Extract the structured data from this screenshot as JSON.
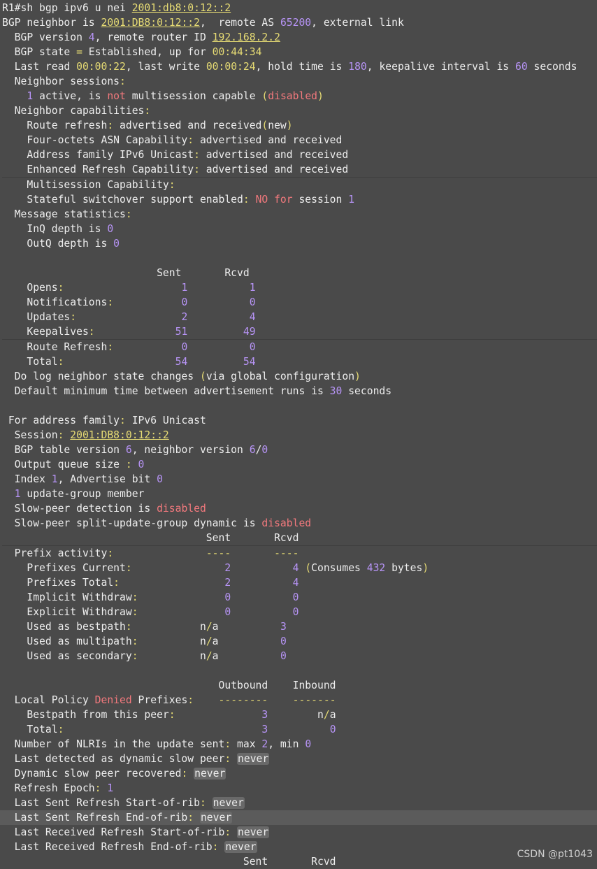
{
  "terminal": {
    "lines": [
      {
        "segs": [
          {
            "t": "R1#sh bgp ipv6 u nei "
          },
          {
            "t": "2001:db8:0:12::2",
            "c": "lnk"
          }
        ]
      },
      {
        "segs": [
          {
            "t": "BGP neighbor is "
          },
          {
            "t": "2001:DB8:0:12::2",
            "c": "lnk"
          },
          {
            "t": ",  remote AS "
          },
          {
            "t": "65200",
            "c": "num"
          },
          {
            "t": ", external link"
          }
        ]
      },
      {
        "segs": [
          {
            "t": "  BGP version "
          },
          {
            "t": "4",
            "c": "num"
          },
          {
            "t": ", remote router ID "
          },
          {
            "t": "192.168.2.2",
            "c": "lnk"
          }
        ]
      },
      {
        "segs": [
          {
            "t": "  BGP state "
          },
          {
            "t": "=",
            "c": "yel"
          },
          {
            "t": " Established, up for "
          },
          {
            "t": "00:44:34",
            "c": "yel"
          }
        ]
      },
      {
        "segs": [
          {
            "t": "  Last read "
          },
          {
            "t": "00:00:22",
            "c": "yel"
          },
          {
            "t": ", last write "
          },
          {
            "t": "00:00:24",
            "c": "yel"
          },
          {
            "t": ", hold time is "
          },
          {
            "t": "180",
            "c": "num"
          },
          {
            "t": ", keepalive interval is "
          },
          {
            "t": "60",
            "c": "num"
          },
          {
            "t": " seconds"
          }
        ]
      },
      {
        "segs": [
          {
            "t": "  Neighbor sessions"
          },
          {
            "t": ":",
            "c": "yel"
          }
        ]
      },
      {
        "segs": [
          {
            "t": "    "
          },
          {
            "t": "1",
            "c": "num"
          },
          {
            "t": " active, is "
          },
          {
            "t": "not",
            "c": "red"
          },
          {
            "t": " multisession capable "
          },
          {
            "t": "(",
            "c": "yel"
          },
          {
            "t": "disabled",
            "c": "red"
          },
          {
            "t": ")",
            "c": "yel"
          }
        ]
      },
      {
        "segs": [
          {
            "t": "  Neighbor capabilities"
          },
          {
            "t": ":",
            "c": "yel"
          }
        ]
      },
      {
        "segs": [
          {
            "t": "    Route refresh"
          },
          {
            "t": ":",
            "c": "yel"
          },
          {
            "t": " advertised and received"
          },
          {
            "t": "(",
            "c": "yel"
          },
          {
            "t": "new"
          },
          {
            "t": ")",
            "c": "yel"
          }
        ]
      },
      {
        "segs": [
          {
            "t": "    Four-octets ASN Capability"
          },
          {
            "t": ":",
            "c": "yel"
          },
          {
            "t": " advertised and received"
          }
        ]
      },
      {
        "segs": [
          {
            "t": "    Address family IPv6 Unicast"
          },
          {
            "t": ":",
            "c": "yel"
          },
          {
            "t": " advertised and received"
          }
        ]
      },
      {
        "segs": [
          {
            "t": "    Enhanced Refresh Capability"
          },
          {
            "t": ":",
            "c": "yel"
          },
          {
            "t": " advertised and received"
          }
        ]
      },
      {
        "sep": true,
        "segs": [
          {
            "t": "    Multisession Capability"
          },
          {
            "t": ":",
            "c": "yel"
          }
        ]
      },
      {
        "segs": [
          {
            "t": "    Stateful switchover support enabled"
          },
          {
            "t": ":",
            "c": "yel"
          },
          {
            "t": " "
          },
          {
            "t": "NO",
            "c": "red"
          },
          {
            "t": " "
          },
          {
            "t": "for",
            "c": "red"
          },
          {
            "t": " session "
          },
          {
            "t": "1",
            "c": "num"
          }
        ]
      },
      {
        "segs": [
          {
            "t": "  Message statistics"
          },
          {
            "t": ":",
            "c": "yel"
          }
        ]
      },
      {
        "segs": [
          {
            "t": "    InQ depth is "
          },
          {
            "t": "0",
            "c": "num"
          }
        ]
      },
      {
        "segs": [
          {
            "t": "    OutQ depth is "
          },
          {
            "t": "0",
            "c": "num"
          }
        ]
      },
      {
        "segs": []
      },
      {
        "segs": [
          {
            "t": "                         Sent       Rcvd"
          }
        ]
      },
      {
        "segs": [
          {
            "t": "    Opens"
          },
          {
            "t": ":",
            "c": "yel"
          },
          {
            "t": "                   "
          },
          {
            "t": "1",
            "c": "num"
          },
          {
            "t": "          "
          },
          {
            "t": "1",
            "c": "num"
          }
        ]
      },
      {
        "segs": [
          {
            "t": "    Notifications"
          },
          {
            "t": ":",
            "c": "yel"
          },
          {
            "t": "           "
          },
          {
            "t": "0",
            "c": "num"
          },
          {
            "t": "          "
          },
          {
            "t": "0",
            "c": "num"
          }
        ]
      },
      {
        "segs": [
          {
            "t": "    Updates"
          },
          {
            "t": ":",
            "c": "yel"
          },
          {
            "t": "                 "
          },
          {
            "t": "2",
            "c": "num"
          },
          {
            "t": "          "
          },
          {
            "t": "4",
            "c": "num"
          }
        ]
      },
      {
        "segs": [
          {
            "t": "    Keepalives"
          },
          {
            "t": ":",
            "c": "yel"
          },
          {
            "t": "             "
          },
          {
            "t": "51",
            "c": "num"
          },
          {
            "t": "         "
          },
          {
            "t": "49",
            "c": "num"
          }
        ]
      },
      {
        "sep": true,
        "segs": [
          {
            "t": "    Route Refresh"
          },
          {
            "t": ":",
            "c": "yel"
          },
          {
            "t": "           "
          },
          {
            "t": "0",
            "c": "num"
          },
          {
            "t": "          "
          },
          {
            "t": "0",
            "c": "num"
          }
        ]
      },
      {
        "segs": [
          {
            "t": "    Total"
          },
          {
            "t": ":",
            "c": "yel"
          },
          {
            "t": "                  "
          },
          {
            "t": "54",
            "c": "num"
          },
          {
            "t": "         "
          },
          {
            "t": "54",
            "c": "num"
          }
        ]
      },
      {
        "segs": [
          {
            "t": "  Do log neighbor state changes "
          },
          {
            "t": "(",
            "c": "yel"
          },
          {
            "t": "via global configuration"
          },
          {
            "t": ")",
            "c": "yel"
          }
        ]
      },
      {
        "segs": [
          {
            "t": "  Default minimum time between advertisement runs is "
          },
          {
            "t": "30",
            "c": "num"
          },
          {
            "t": " seconds"
          }
        ]
      },
      {
        "segs": []
      },
      {
        "segs": [
          {
            "t": " For address family"
          },
          {
            "t": ":",
            "c": "yel"
          },
          {
            "t": " IPv6 Unicast"
          }
        ]
      },
      {
        "segs": [
          {
            "t": "  Session"
          },
          {
            "t": ":",
            "c": "yel"
          },
          {
            "t": " "
          },
          {
            "t": "2001:DB8:0:12::2",
            "c": "lnk"
          }
        ]
      },
      {
        "segs": [
          {
            "t": "  BGP table version "
          },
          {
            "t": "6",
            "c": "num"
          },
          {
            "t": ", neighbor version "
          },
          {
            "t": "6",
            "c": "num"
          },
          {
            "t": "/"
          },
          {
            "t": "0",
            "c": "num"
          }
        ]
      },
      {
        "segs": [
          {
            "t": "  Output queue size "
          },
          {
            "t": ":",
            "c": "yel"
          },
          {
            "t": " "
          },
          {
            "t": "0",
            "c": "num"
          }
        ]
      },
      {
        "segs": [
          {
            "t": "  Index "
          },
          {
            "t": "1",
            "c": "num"
          },
          {
            "t": ", Advertise bit "
          },
          {
            "t": "0",
            "c": "num"
          }
        ]
      },
      {
        "segs": [
          {
            "t": "  "
          },
          {
            "t": "1",
            "c": "num"
          },
          {
            "t": " update-group member"
          }
        ]
      },
      {
        "segs": [
          {
            "t": "  Slow-peer detection is "
          },
          {
            "t": "disabled",
            "c": "red"
          }
        ]
      },
      {
        "segs": [
          {
            "t": "  Slow-peer split-update-group dynamic is "
          },
          {
            "t": "disabled",
            "c": "red"
          }
        ]
      },
      {
        "segs": [
          {
            "t": "                                 Sent       Rcvd"
          }
        ]
      },
      {
        "sep": true,
        "segs": [
          {
            "t": "  Prefix activity"
          },
          {
            "t": ":",
            "c": "yel"
          },
          {
            "t": "               "
          },
          {
            "t": "----",
            "c": "yel"
          },
          {
            "t": "       "
          },
          {
            "t": "----",
            "c": "yel"
          }
        ]
      },
      {
        "segs": [
          {
            "t": "    Prefixes Current"
          },
          {
            "t": ":",
            "c": "yel"
          },
          {
            "t": "               "
          },
          {
            "t": "2",
            "c": "num"
          },
          {
            "t": "          "
          },
          {
            "t": "4",
            "c": "num"
          },
          {
            "t": " "
          },
          {
            "t": "(",
            "c": "yel"
          },
          {
            "t": "Consumes "
          },
          {
            "t": "432",
            "c": "num"
          },
          {
            "t": " bytes"
          },
          {
            "t": ")",
            "c": "yel"
          }
        ]
      },
      {
        "segs": [
          {
            "t": "    Prefixes Total"
          },
          {
            "t": ":",
            "c": "yel"
          },
          {
            "t": "                 "
          },
          {
            "t": "2",
            "c": "num"
          },
          {
            "t": "          "
          },
          {
            "t": "4",
            "c": "num"
          }
        ]
      },
      {
        "segs": [
          {
            "t": "    Implicit Withdraw"
          },
          {
            "t": ":",
            "c": "yel"
          },
          {
            "t": "              "
          },
          {
            "t": "0",
            "c": "num"
          },
          {
            "t": "          "
          },
          {
            "t": "0",
            "c": "num"
          }
        ]
      },
      {
        "segs": [
          {
            "t": "    Explicit Withdraw"
          },
          {
            "t": ":",
            "c": "yel"
          },
          {
            "t": "              "
          },
          {
            "t": "0",
            "c": "num"
          },
          {
            "t": "          "
          },
          {
            "t": "0",
            "c": "num"
          }
        ]
      },
      {
        "segs": [
          {
            "t": "    Used as bestpath"
          },
          {
            "t": ":",
            "c": "yel"
          },
          {
            "t": "           n"
          },
          {
            "t": "/",
            "c": "yel"
          },
          {
            "t": "a          "
          },
          {
            "t": "3",
            "c": "num"
          }
        ]
      },
      {
        "segs": [
          {
            "t": "    Used as multipath"
          },
          {
            "t": ":",
            "c": "yel"
          },
          {
            "t": "          n"
          },
          {
            "t": "/",
            "c": "yel"
          },
          {
            "t": "a          "
          },
          {
            "t": "0",
            "c": "num"
          }
        ]
      },
      {
        "segs": [
          {
            "t": "    Used as secondary"
          },
          {
            "t": ":",
            "c": "yel"
          },
          {
            "t": "          n"
          },
          {
            "t": "/",
            "c": "yel"
          },
          {
            "t": "a          "
          },
          {
            "t": "0",
            "c": "num"
          }
        ]
      },
      {
        "segs": []
      },
      {
        "segs": [
          {
            "t": "                                   Outbound    Inbound"
          }
        ]
      },
      {
        "segs": [
          {
            "t": "  Local Policy "
          },
          {
            "t": "Denied",
            "c": "red"
          },
          {
            "t": " Prefixes"
          },
          {
            "t": ":",
            "c": "yel"
          },
          {
            "t": "    "
          },
          {
            "t": "--------",
            "c": "yel"
          },
          {
            "t": "    "
          },
          {
            "t": "-------",
            "c": "yel"
          }
        ]
      },
      {
        "segs": [
          {
            "t": "    Bestpath from this peer"
          },
          {
            "t": ":",
            "c": "yel"
          },
          {
            "t": "              "
          },
          {
            "t": "3",
            "c": "num"
          },
          {
            "t": "        n"
          },
          {
            "t": "/",
            "c": "yel"
          },
          {
            "t": "a"
          }
        ]
      },
      {
        "segs": [
          {
            "t": "    Total"
          },
          {
            "t": ":",
            "c": "yel"
          },
          {
            "t": "                                "
          },
          {
            "t": "3",
            "c": "num"
          },
          {
            "t": "          "
          },
          {
            "t": "0",
            "c": "num"
          }
        ]
      },
      {
        "segs": [
          {
            "t": "  Number of NLRIs in the update sent"
          },
          {
            "t": ":",
            "c": "yel"
          },
          {
            "t": " max "
          },
          {
            "t": "2",
            "c": "num"
          },
          {
            "t": ", min "
          },
          {
            "t": "0",
            "c": "num"
          }
        ]
      },
      {
        "segs": [
          {
            "t": "  Last detected as dynamic slow peer"
          },
          {
            "t": ":",
            "c": "yel"
          },
          {
            "t": " "
          },
          {
            "t": "never",
            "c": "pill"
          }
        ]
      },
      {
        "segs": [
          {
            "t": "  Dynamic slow peer recovered"
          },
          {
            "t": ":",
            "c": "yel"
          },
          {
            "t": " "
          },
          {
            "t": "never",
            "c": "pill"
          }
        ]
      },
      {
        "segs": [
          {
            "t": "  Refresh Epoch"
          },
          {
            "t": ":",
            "c": "yel"
          },
          {
            "t": " "
          },
          {
            "t": "1",
            "c": "num"
          }
        ]
      },
      {
        "segs": [
          {
            "t": "  Last Sent Refresh Start-of-rib"
          },
          {
            "t": ":",
            "c": "yel"
          },
          {
            "t": " "
          },
          {
            "t": "never",
            "c": "pill"
          }
        ]
      },
      {
        "hl": true,
        "segs": [
          {
            "t": "  Last Sent Refresh End-of-rib"
          },
          {
            "t": ":",
            "c": "yel"
          },
          {
            "t": " "
          },
          {
            "t": "never",
            "c": "pill"
          }
        ]
      },
      {
        "segs": [
          {
            "t": "  Last Received Refresh Start-of-rib"
          },
          {
            "t": ":",
            "c": "yel"
          },
          {
            "t": " "
          },
          {
            "t": "never",
            "c": "pill"
          }
        ]
      },
      {
        "segs": [
          {
            "t": "  Last Received Refresh End-of-rib"
          },
          {
            "t": ":",
            "c": "yel"
          },
          {
            "t": " "
          },
          {
            "t": "never",
            "c": "pill"
          }
        ]
      },
      {
        "segs": [
          {
            "t": "                                       Sent       Rcvd"
          }
        ]
      }
    ]
  },
  "watermark": "CSDN @pt1043",
  "colors": {
    "background": "#4a4a4a",
    "text": "#ededed",
    "number": "#b794f6",
    "keyword_red": "#f2797d",
    "punctuation_yellow": "#e6db74",
    "highlight_row": "#5b5b5b"
  }
}
